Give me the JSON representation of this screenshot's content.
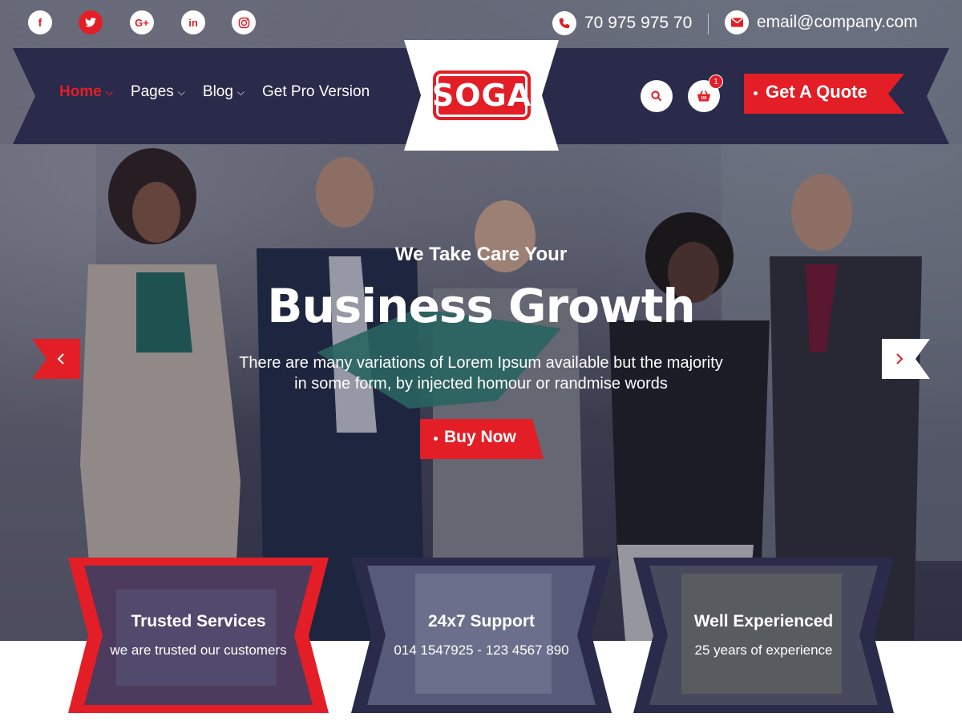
{
  "social": [
    {
      "icon": "facebook-icon",
      "glyph": "f"
    },
    {
      "icon": "twitter-icon",
      "glyph": "t"
    },
    {
      "icon": "google-plus-icon",
      "glyph": "G+"
    },
    {
      "icon": "linkedin-icon",
      "glyph": "in"
    },
    {
      "icon": "instagram-icon",
      "glyph": "◎"
    }
  ],
  "contact": {
    "phone": "70 975 975 70",
    "email": "email@company.com"
  },
  "nav": {
    "items": [
      {
        "label": "Home",
        "has_dropdown": true,
        "active": true
      },
      {
        "label": "Pages",
        "has_dropdown": true,
        "active": false
      },
      {
        "label": "Blog",
        "has_dropdown": true,
        "active": false
      },
      {
        "label": "Get Pro Version",
        "has_dropdown": false,
        "active": false
      }
    ]
  },
  "logo": {
    "text": "SOGA"
  },
  "cart": {
    "count": "1"
  },
  "quote_button": {
    "label": "Get A Quote"
  },
  "hero": {
    "subtitle": "We Take Care Your",
    "title": "Business Growth",
    "description_line1": "There are many variations of Lorem Ipsum available but the majority",
    "description_line2": "in some form, by injected homour or randmise words",
    "button_label": "Buy Now",
    "prev_glyph": "‹",
    "next_glyph": "›"
  },
  "features": [
    {
      "title": "Trusted Services",
      "text": "we are trusted our customers"
    },
    {
      "title": "24x7 Support",
      "text": "014 1547925 - 123 4567 890"
    },
    {
      "title": "Well Experienced",
      "text": "25 years of experience"
    }
  ],
  "colors": {
    "accent": "#e31e26",
    "navy": "#2a2a4a",
    "white": "#ffffff"
  }
}
